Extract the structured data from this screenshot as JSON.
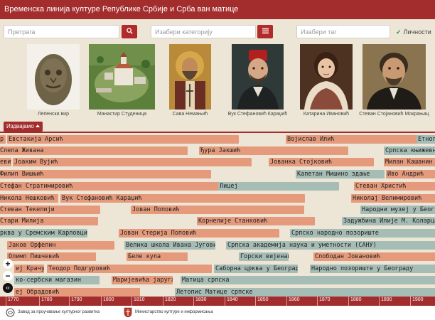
{
  "header": {
    "title": "Временска линија културе Републике Србије и Срба ван матице"
  },
  "toolbar": {
    "search_placeholder": "Претрага",
    "category_placeholder": "Изабери категорију",
    "tag_placeholder": "Изабери таг",
    "tag_chip": "Личности"
  },
  "gallery": [
    {
      "caption": "Лепенски вир"
    },
    {
      "caption": "Манастир Студеница"
    },
    {
      "caption": "Сава Немањић"
    },
    {
      "caption": "Вук Стефановић Караџић"
    },
    {
      "caption": "Катарина Ивановић"
    },
    {
      "caption": "Стеван Стојановић Мокрањац"
    }
  ],
  "selector": {
    "label": "Издвајамо"
  },
  "timeline": {
    "items": [
      {
        "label": "р",
        "color": "pink"
      },
      {
        "label": "Евстакија Арсић",
        "color": "pink"
      },
      {
        "label": "Војислав Илић",
        "color": "pink"
      },
      {
        "label": "Етногр",
        "color": "green"
      },
      {
        "label": "Слепа Живана",
        "color": "pink"
      },
      {
        "label": "Ђура Јакшић",
        "color": "pink"
      },
      {
        "label": "Српска књижевно",
        "color": "green"
      },
      {
        "label": "евић",
        "color": "pink"
      },
      {
        "label": "Јоаким Вујић",
        "color": "pink"
      },
      {
        "label": "Јованка Стојковић",
        "color": "pink"
      },
      {
        "label": "Милан Кашанин",
        "color": "pink"
      },
      {
        "label": "Филип Вишњић",
        "color": "pink"
      },
      {
        "label": "Капетан Мишино здање",
        "color": "green"
      },
      {
        "label": "Иво Андрић",
        "color": "pink"
      },
      {
        "label": "Стефан Стратимировић",
        "color": "pink"
      },
      {
        "label": "Лицеј",
        "color": "green"
      },
      {
        "label": "Стеван Христић",
        "color": "pink"
      },
      {
        "label": "Никола Нешковић",
        "color": "pink"
      },
      {
        "label": "Вук Стефановић Караџић",
        "color": "pink"
      },
      {
        "label": "Николај Велимировић",
        "color": "pink"
      },
      {
        "label": "Стеван Текелији",
        "color": "pink"
      },
      {
        "label": "Јован Поповић",
        "color": "pink"
      },
      {
        "label": "Народни музеј у Београду",
        "color": "green"
      },
      {
        "label": "Стари Милија",
        "color": "pink"
      },
      {
        "label": "Корнелије Станковић",
        "color": "pink"
      },
      {
        "label": "Задужбина Илије М. Коларца",
        "color": "green"
      },
      {
        "label": "рква у Сремским Карловцима",
        "color": "green"
      },
      {
        "label": "Јован Стерија Поповић",
        "color": "pink"
      },
      {
        "label": "Српско народно позориште",
        "color": "green"
      },
      {
        "label": "Јаков Орфелин",
        "color": "pink"
      },
      {
        "label": "Велика школа Ивана Југовића",
        "color": "green"
      },
      {
        "label": "Српска академија наука и уметности (САНУ)",
        "color": "green"
      },
      {
        "label": "Олимп Пишчевић",
        "color": "pink"
      },
      {
        "label": "Беле кула",
        "color": "pink"
      },
      {
        "label": "Горски вијенац",
        "color": "green"
      },
      {
        "label": "Слободан Јовановић",
        "color": "pink"
      },
      {
        "label": "иј Крачун",
        "color": "pink"
      },
      {
        "label": "Теодор Подгуровић",
        "color": "pink"
      },
      {
        "label": "Саборна црква у Београду",
        "color": "green"
      },
      {
        "label": "Народно позориште у Београду",
        "color": "green"
      },
      {
        "label": "ко-сербски магазин",
        "color": "green"
      },
      {
        "label": "Маријевића јаруга",
        "color": "pink"
      },
      {
        "label": "Матица српска",
        "color": "green"
      },
      {
        "label": "еј Обрадовић",
        "color": "pink"
      },
      {
        "label": "Летопис Матице српске",
        "color": "green"
      }
    ]
  },
  "controls": {
    "zoom_in": "+",
    "zoom_out": "−",
    "fit": "‹›"
  },
  "axis": {
    "ticks": [
      "1770",
      "1780",
      "1790",
      "1800",
      "1810",
      "1820",
      "1830",
      "1840",
      "1850",
      "1860",
      "1870",
      "1880",
      "1890",
      "1900"
    ]
  },
  "footer": {
    "left_org": "Завод за проучавање културног развитка",
    "right_org": "Министарство културе и информисања"
  },
  "colors": {
    "brand": "#a32c2c",
    "bar_person": "#e69a7c",
    "bar_institution": "#a6bdb6",
    "background": "#ede6d6"
  }
}
